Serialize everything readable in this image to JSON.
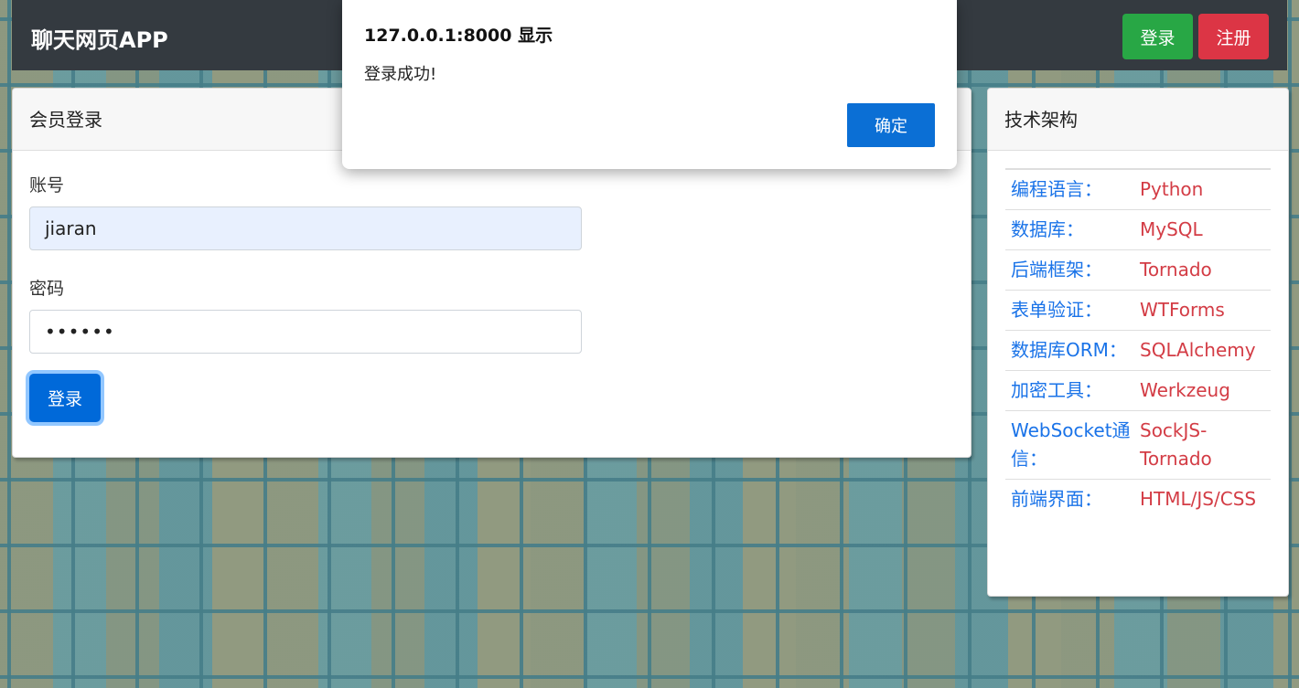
{
  "navbar": {
    "brand": "聊天网页APP",
    "login_label": "登录",
    "register_label": "注册",
    "login_color": "#28a745",
    "register_color": "#dc3545"
  },
  "login_card": {
    "title": "会员登录",
    "account_label": "账号",
    "account_value": "jiaran",
    "password_label": "密码",
    "password_value": "••••••",
    "submit_label": "登录"
  },
  "tech_card": {
    "title": "技术架构",
    "rows": [
      {
        "key": "编程语言：",
        "value": "Python"
      },
      {
        "key": "数据库：",
        "value": "MySQL"
      },
      {
        "key": "后端框架：",
        "value": "Tornado"
      },
      {
        "key": "表单验证：",
        "value": "WTForms"
      },
      {
        "key": "数据库ORM：",
        "value": "SQLAlchemy"
      },
      {
        "key": "加密工具：",
        "value": "Werkzeug"
      },
      {
        "key": "WebSocket通信：",
        "value": "SockJS-Tornado"
      },
      {
        "key": "前端界面：",
        "value": "HTML/JS/CSS"
      }
    ]
  },
  "dialog": {
    "title": "127.0.0.1:8000 显示",
    "message": "登录成功!",
    "ok_label": "确定"
  }
}
